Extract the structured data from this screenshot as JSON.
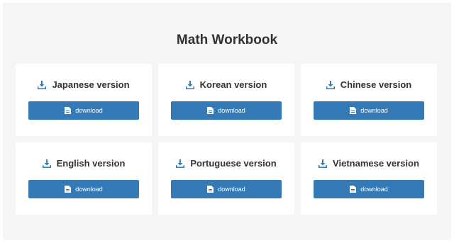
{
  "page": {
    "title": "Math Workbook"
  },
  "cards": [
    {
      "heading": "Japanese version",
      "button_label": "download"
    },
    {
      "heading": "Korean version",
      "button_label": "download"
    },
    {
      "heading": "Chinese version",
      "button_label": "download"
    },
    {
      "heading": "English version",
      "button_label": "download"
    },
    {
      "heading": "Portuguese version",
      "button_label": "download"
    },
    {
      "heading": "Vietnamese version",
      "button_label": "download"
    }
  ],
  "icons": {
    "heading": "download-icon",
    "button": "file-icon"
  },
  "colors": {
    "accent": "#337ab7",
    "panel_bg": "#f5f5f5",
    "card_bg": "#ffffff",
    "text": "#333333"
  }
}
